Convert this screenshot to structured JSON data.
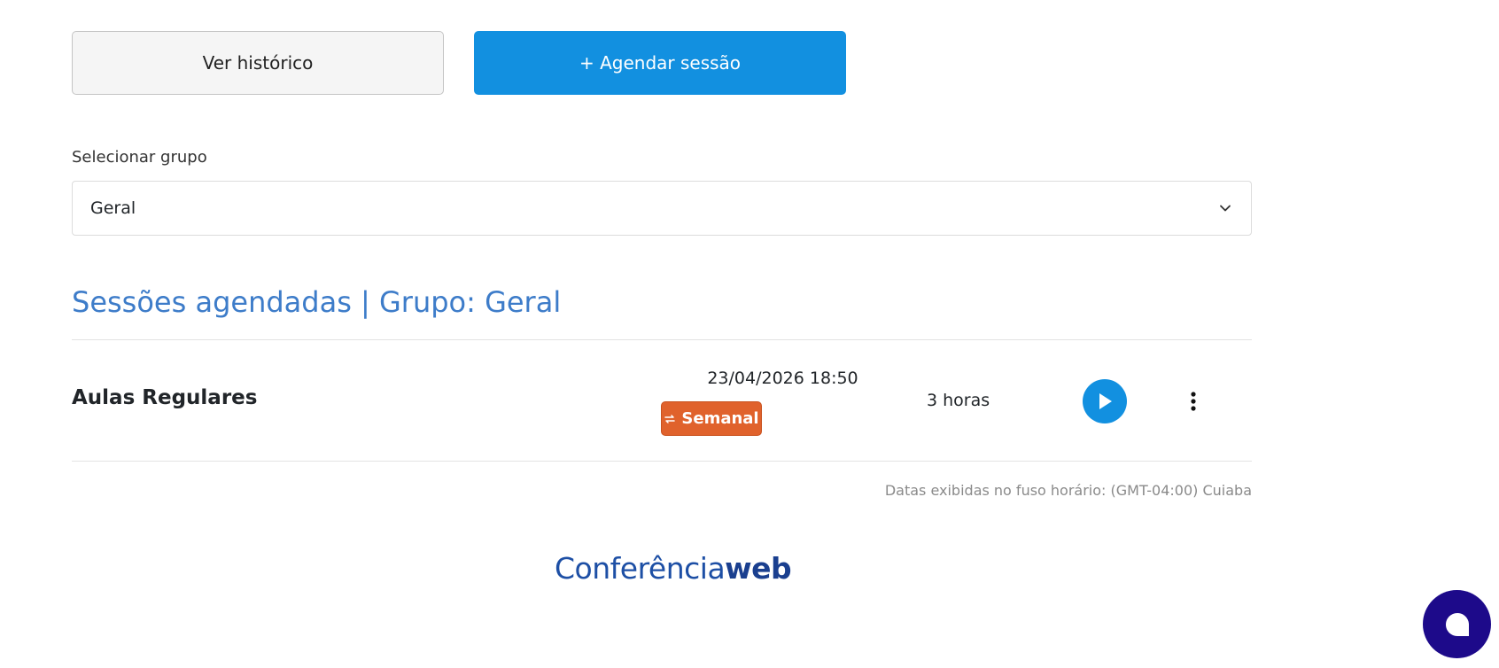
{
  "actions": {
    "history_label": "Ver histórico",
    "schedule_label": "+ Agendar sessão"
  },
  "group_select": {
    "label": "Selecionar grupo",
    "value": "Geral"
  },
  "sessions": {
    "title": "Sessões agendadas | Grupo: Geral",
    "items": [
      {
        "name": "Aulas Regulares",
        "datetime": "23/04/2026 18:50",
        "recurrence": "Semanal",
        "duration": "3 horas"
      }
    ],
    "timezone_note": "Datas exibidas no fuso horário: (GMT-04:00) Cuiaba"
  },
  "footer": {
    "logo_regular": "Conferência",
    "logo_bold": "web"
  },
  "colors": {
    "primary": "#1290e0",
    "title_blue": "#3d7cc9",
    "badge_orange": "#e0622c",
    "chat_navy": "#1d0a8a",
    "logo_blue": "#1d4fa5"
  },
  "icons": {
    "select_chevron": "chevron-down-icon",
    "badge": "repeat-icon",
    "play": "play-icon",
    "more": "more-vertical-icon",
    "chat": "chat-bubble-icon"
  }
}
